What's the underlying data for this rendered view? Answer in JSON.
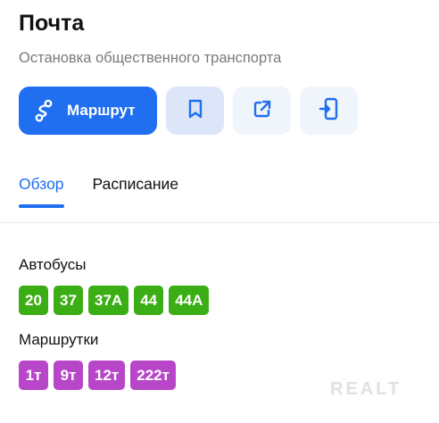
{
  "header": {
    "title": "Почта",
    "subtitle": "Остановка общественного транспорта"
  },
  "actions": {
    "route_label": "Маршрут",
    "route_icon": "route-icon",
    "bookmark_icon": "bookmark-icon",
    "share_icon": "share-icon",
    "send_to_phone_icon": "send-to-phone-icon"
  },
  "tabs": [
    {
      "label": "Обзор",
      "active": true
    },
    {
      "label": "Расписание",
      "active": false
    }
  ],
  "buses": {
    "label": "Автобусы",
    "color": "#3cae15",
    "routes": [
      "20",
      "37",
      "37А",
      "44",
      "44А"
    ]
  },
  "minibuses": {
    "label": "Маршрутки",
    "color": "#b846c8",
    "routes": [
      "1т",
      "9т",
      "12т",
      "222т"
    ]
  },
  "colors": {
    "accent": "#1f6ff0"
  },
  "watermark": "REALT"
}
